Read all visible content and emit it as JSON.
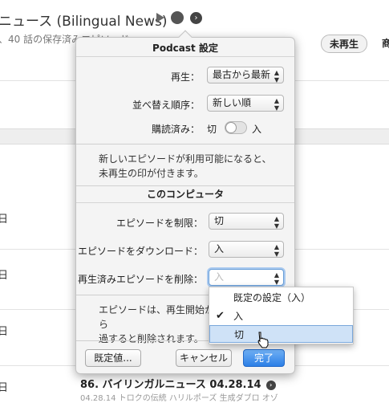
{
  "background": {
    "title": "ニュース (Bilingual News)",
    "subtitle": "、40 話の保存済みエピソード",
    "unplayed_pill": "未再生",
    "trunc_char": "商",
    "day_rows": [
      "日",
      "日",
      "日",
      "日",
      "日"
    ],
    "episode_title": "86. バイリンガルニュース 04.28.14",
    "episode_sub": "04.28.14 トロクの伝統 ハリルポーズ 生成ダブロ オゾ"
  },
  "popover": {
    "header_podcast": "Podcast 設定",
    "playback_label": "再生：",
    "playback_value": "最古から最新",
    "sort_label": "並べ替え順序：",
    "sort_value": "新しい順",
    "subscribed_label": "購読済み：",
    "toggle_off": "切",
    "toggle_on": "入",
    "note1": "新しいエピソードが利用可能になると、未再生の印が付きます。",
    "header_computer": "このコンピュータ",
    "limit_label": "エピソードを制限：",
    "limit_value": "切",
    "download_label": "エピソードをダウンロード：",
    "download_value": "入",
    "delete_label": "再生済みエピソードを削除：",
    "delete_value": "入",
    "note2_line1": "エピソードは、再生開始から",
    "note2_line2": "過すると削除されます。",
    "defaults_button": "既定値...",
    "cancel_button": "キャンセル",
    "done_button": "完了"
  },
  "dropdown": {
    "options": [
      "既定の設定（入）",
      "入",
      "切"
    ],
    "checked_index": 1,
    "highlighted_index": 2
  }
}
